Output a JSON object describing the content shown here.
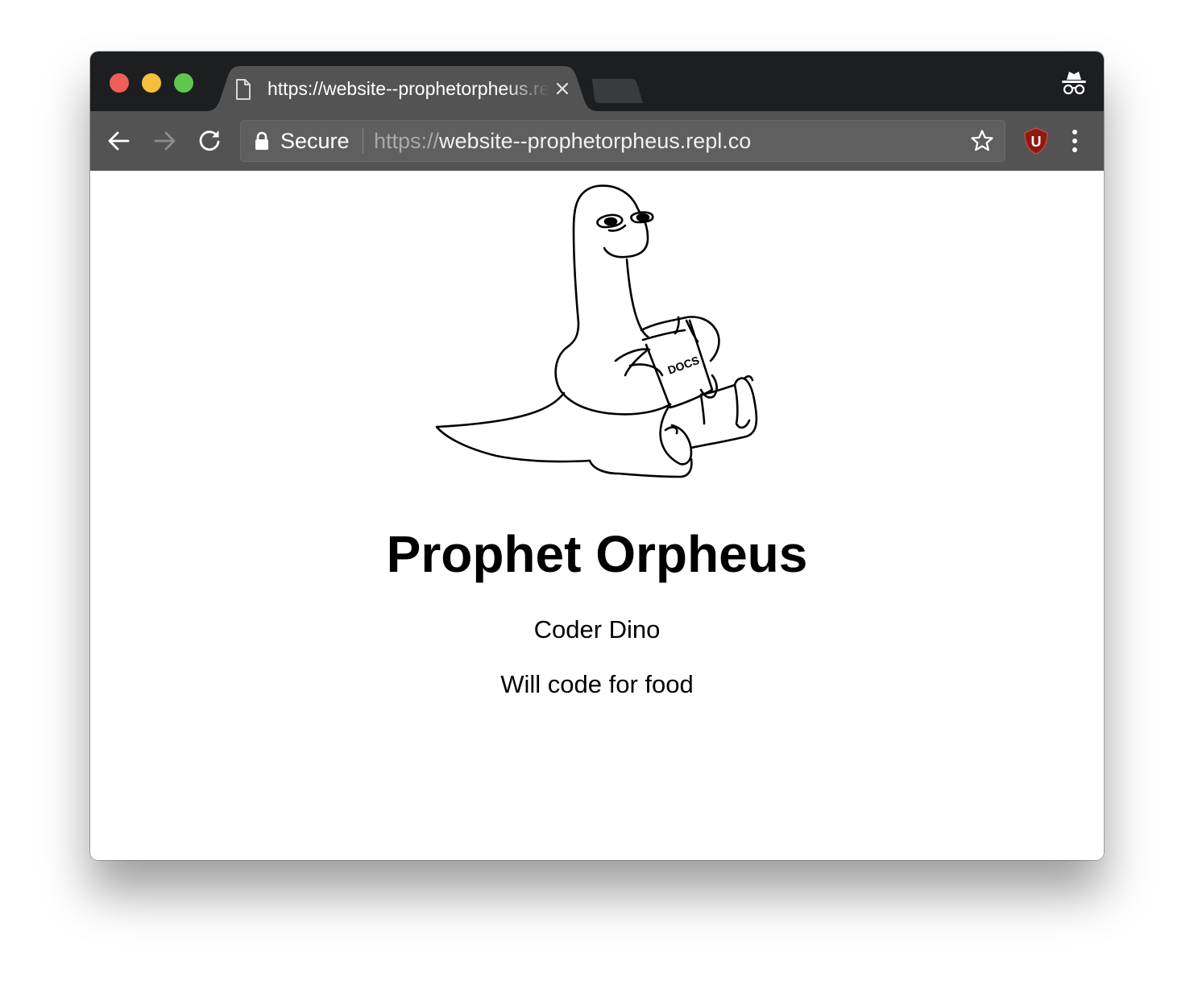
{
  "browser": {
    "tab": {
      "title": "https://website--prophetorpheus.repl.co"
    },
    "omnibox": {
      "security_label": "Secure",
      "url_scheme": "https://",
      "url_host": "website--prophetorpheus.repl.co"
    },
    "extension_badge": "U",
    "icons": [
      "page-icon",
      "close-icon",
      "incognito-icon",
      "back-arrow-icon",
      "forward-arrow-icon",
      "reload-icon",
      "lock-icon",
      "star-icon",
      "ublock-icon",
      "kebab-menu-icon"
    ],
    "colors": {
      "titlebar": "#1d1e20",
      "toolbar": "#535353",
      "tab": "#535353",
      "extension": "#8b1a10"
    }
  },
  "page": {
    "heading": "Prophet Orpheus",
    "lines": [
      "Coder Dino",
      "Will code for food"
    ],
    "illustration": {
      "book_label": "DOCS"
    }
  }
}
